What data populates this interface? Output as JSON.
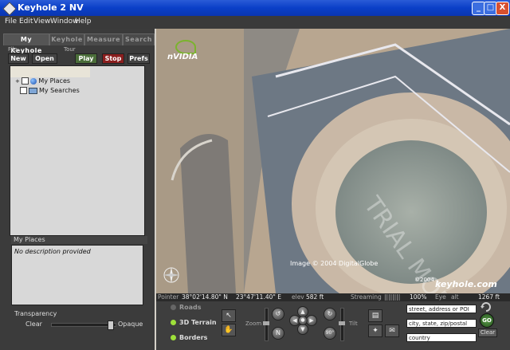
{
  "window": {
    "title": "Keyhole 2 NV",
    "min_label": "_",
    "max_label": "□",
    "close_label": "X"
  },
  "menu": [
    "File",
    "Edit",
    "View",
    "Window",
    "Help"
  ],
  "tabs": [
    "My Keyhole",
    "Keyhole",
    "Measure",
    "Search"
  ],
  "toolbar": {
    "file_label": "File",
    "tour_label": "Tour",
    "new_label": "New",
    "open_label": "Open",
    "play_label": "Play",
    "stop_label": "Stop",
    "prefs_label": "Prefs"
  },
  "tree": {
    "my_places": "My Places",
    "my_searches": "My Searches"
  },
  "places": {
    "header": "My Places",
    "description": "No description provided"
  },
  "transparency": {
    "title": "Transparency",
    "min_label": "Clear",
    "max_label": "Opaque",
    "value": 0.95
  },
  "map": {
    "logo_text": "nVIDIA",
    "watermark": "TRIAL MODE",
    "copyright": "Image © 2004 DigitalGlobe",
    "small_copyright": "©2004",
    "brand": "keyhole.com"
  },
  "status": {
    "pointer_label": "Pointer",
    "lat": "38°02'14.80\" N",
    "lon": "23°47'11.40\" E",
    "elev_label": "elev",
    "elev": "582 ft",
    "streaming_label": "Streaming",
    "streaming_bar": "||||||||",
    "streaming_pct": "100%",
    "eye_label": "Eye",
    "alt_label": "alt",
    "alt": "1267 ft"
  },
  "layers": [
    {
      "label": "Roads",
      "on": false
    },
    {
      "label": "3D Terrain",
      "on": true
    },
    {
      "label": "Borders",
      "on": true
    }
  ],
  "nav": {
    "zoom_label": "Zoom",
    "tilt_label": "Tilt",
    "reset_north": "N",
    "reset_tilt": "90°"
  },
  "search": {
    "street_placeholder": "street, address or POI",
    "city_placeholder": "city, state, zip/postal",
    "country_placeholder": "country",
    "go_label": "GO",
    "clear_label": "Clear"
  },
  "colors": {
    "titlebar": "#0a3fc7",
    "panel": "#3b3b3b",
    "play": "#4b6e3a",
    "stop": "#8a1e1e"
  }
}
